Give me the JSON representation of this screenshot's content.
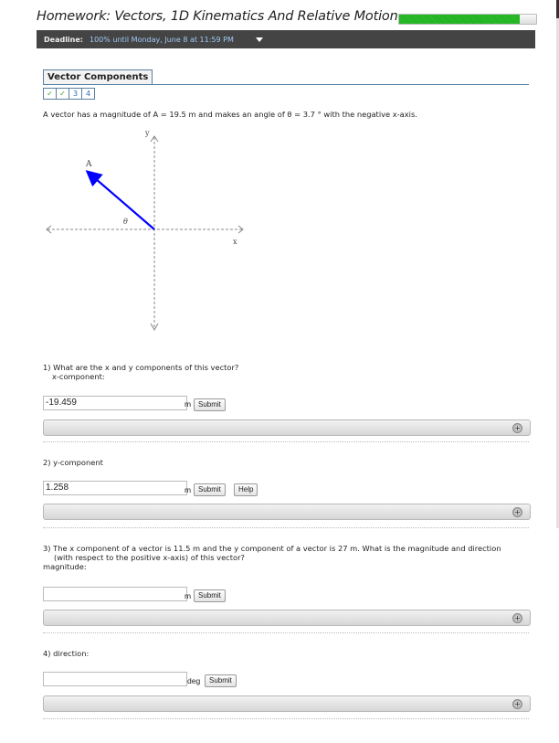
{
  "header": {
    "title": "Homework: Vectors, 1D Kinematics And Relative Motion",
    "progress_percent": 88
  },
  "deadline": {
    "label": "Deadline:",
    "value": "100% until Monday, June 8 at 11:59 PM",
    "dropdown_icon": "caret-down-icon"
  },
  "section": {
    "title": "Vector Components",
    "question_nav": [
      {
        "label": "✓",
        "status": "correct"
      },
      {
        "label": "✓",
        "status": "correct"
      },
      {
        "label": "3",
        "status": "open"
      },
      {
        "label": "4",
        "status": "open"
      }
    ]
  },
  "problem": {
    "text": "A vector has a magnitude of A = 19.5 m and makes an angle of θ = 3.7 ° with the negative x-axis.",
    "diagram": {
      "vector_label": "A",
      "angle_label": "θ",
      "x_axis_label": "x",
      "y_axis_label": "y",
      "vector_color": "#0000ff"
    }
  },
  "questions": [
    {
      "prompt_line1": "1) What are the x and y components of this vector?",
      "prompt_line2": "x-component:",
      "value": "-19.459",
      "unit": "m",
      "submit": "Submit"
    },
    {
      "prompt_line1": "2) y-component",
      "value": "1.258",
      "unit": "m",
      "submit": "Submit",
      "help": "Help"
    },
    {
      "prompt_line1": "3) The x component of a vector is 11.5 m and the y component of a vector is 27 m. What is the magnitude and direction",
      "prompt_line2": "(with respect to the positive x-axis) of this vector?",
      "prompt_line3": "magnitude:",
      "value": "",
      "unit": "m",
      "submit": "Submit"
    },
    {
      "prompt_line1": "4) direction:",
      "value": "",
      "unit": "deg",
      "submit": "Submit"
    }
  ],
  "feedback_expand_icon": "+"
}
